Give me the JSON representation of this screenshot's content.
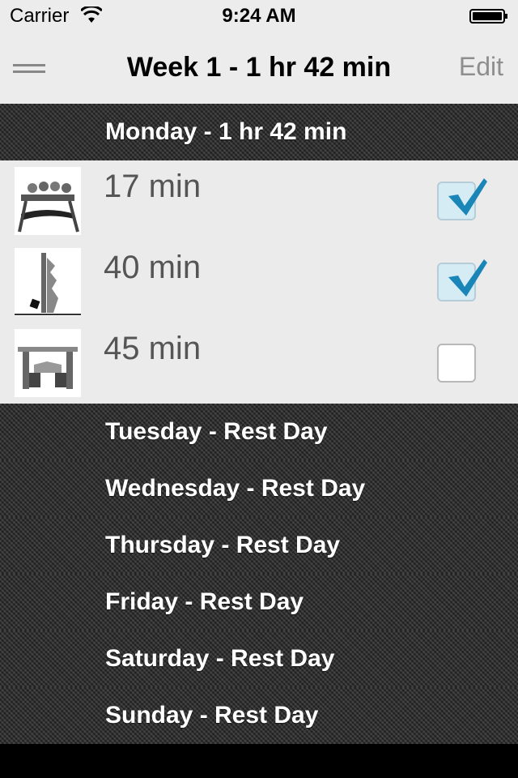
{
  "status_bar": {
    "carrier": "Carrier",
    "time": "9:24 AM"
  },
  "nav": {
    "menu_icon": "hamburger-icon",
    "title": "Week 1 - 1 hr 42 min",
    "edit_label": "Edit"
  },
  "days": [
    {
      "label": "Monday - 1 hr 42 min",
      "workouts": [
        {
          "duration": "17 min",
          "checked": true,
          "thumb_icon": "kettlebell-rack-icon"
        },
        {
          "duration": "40 min",
          "checked": true,
          "thumb_icon": "vertical-rack-icon"
        },
        {
          "duration": "45 min",
          "checked": false,
          "thumb_icon": "weight-bench-icon"
        }
      ]
    },
    {
      "label": "Tuesday - Rest Day"
    },
    {
      "label": "Wednesday - Rest Day"
    },
    {
      "label": "Thursday - Rest Day"
    },
    {
      "label": "Friday - Rest Day"
    },
    {
      "label": "Saturday - Rest Day"
    },
    {
      "label": "Sunday - Rest Day"
    }
  ],
  "colors": {
    "nav_background": "#ececec",
    "day_header_background": "#2c2c2c",
    "workout_list_background": "#ebebeb",
    "check_blue": "#1a86b8"
  }
}
